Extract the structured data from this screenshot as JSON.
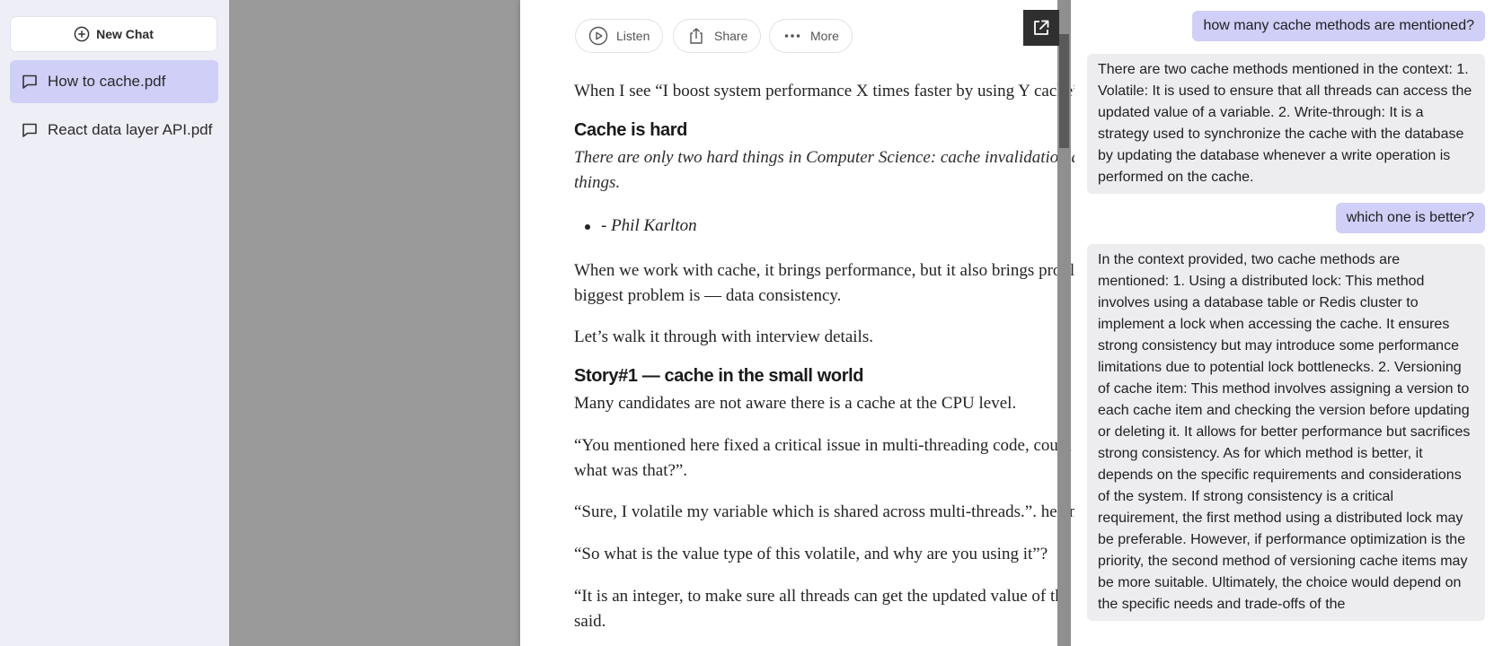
{
  "sidebar": {
    "new_chat_label": "New Chat",
    "items": [
      {
        "label": "How to cache.pdf",
        "active": true
      },
      {
        "label": "React data layer API.pdf",
        "active": false
      }
    ]
  },
  "viewer": {
    "toolbar": {
      "listen": "Listen",
      "share": "Share",
      "more": "More"
    },
    "article": {
      "intro": "When I see “I boost system performance X times faster by using Y cache”",
      "heading1": "Cache is hard",
      "quote": "There are only two hard things in Computer Science: cache invalidation and naming things.",
      "quote_author": "- Phil Karlton",
      "para1": "When we work with cache, it brings performance, but it also brings problems. the biggest problem is — data consistency.",
      "para2": "Let’s walk it through with interview details.",
      "heading2": "Story#1 — cache in the small world",
      "para3": "Many candidates are not aware there is a cache at the CPU level.",
      "para4": "“You mentioned here fixed a critical issue in multi-threading code, could you explain what was that?”.",
      "para5": "“Sure, I volatile my variable which is shared across multi-threads.”. he answered.",
      "para6": "“So what is the value type of this volatile, and why are you using it”?",
      "para7": "“It is an integer, to make sure all threads can get the updated value of the variable”, he said."
    }
  },
  "chat": {
    "messages": [
      {
        "role": "user",
        "text": "how many cache methods are mentioned?"
      },
      {
        "role": "assistant",
        "text": "There are two cache methods mentioned in the context: 1. Volatile: It is used to ensure that all threads can access the updated value of a variable. 2. Write-through: It is a strategy used to synchronize the cache with the database by updating the database whenever a write operation is performed on the cache."
      },
      {
        "role": "user",
        "text": "which one is better?"
      },
      {
        "role": "assistant",
        "text": "In the context provided, two cache methods are mentioned: 1. Using a distributed lock: This method involves using a database table or Redis cluster to implement a lock when accessing the cache. It ensures strong consistency but may introduce some performance limitations due to potential lock bottlenecks. 2. Versioning of cache item: This method involves assigning a version to each cache item and checking the version before updating or deleting it. It allows for better performance but sacrifices strong consistency. As for which method is better, it depends on the specific requirements and considerations of the system. If strong consistency is a critical requirement, the first method using a distributed lock may be preferable. However, if performance optimization is the priority, the second method of versioning cache items may be more suitable. Ultimately, the choice would depend on the specific needs and trade-offs of the"
      }
    ]
  },
  "colors": {
    "sidebar_bg": "#eeeef7",
    "active_item": "#cfcff7",
    "user_bubble": "#cfcff7",
    "bot_bubble": "#ededf0",
    "viewer_bg": "#9a9a9a"
  },
  "icons": {
    "new_chat": "plus-circle-icon",
    "chat_item": "chat-bubble-icon",
    "listen": "play-circle-icon",
    "share": "share-icon",
    "more": "more-dots-icon",
    "popout": "external-link-icon"
  }
}
